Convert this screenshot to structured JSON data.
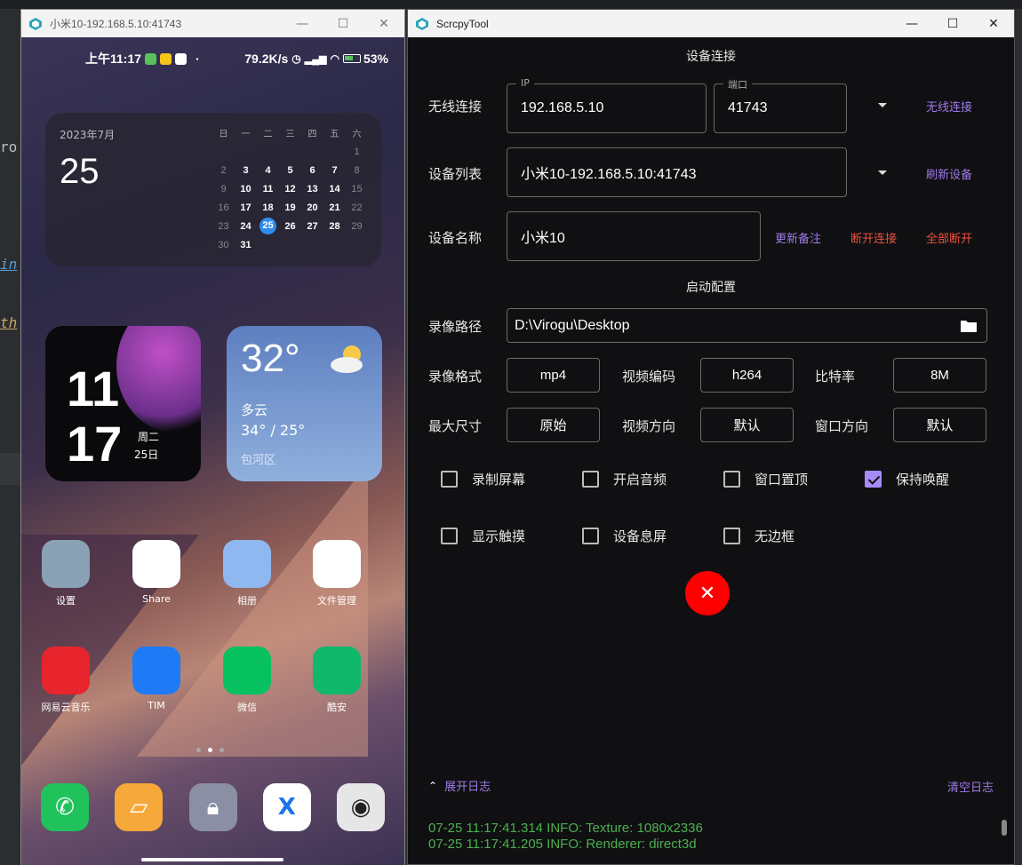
{
  "ide": {
    "frag1": "ro",
    "frag2": "in",
    "frag3": "th"
  },
  "phone_window": {
    "title": "小米10-192.168.5.10:41743",
    "minimize": "—",
    "maximize": "☐",
    "close": "✕"
  },
  "phone": {
    "status": {
      "time": "上午11:17",
      "speed": "79.2K/s",
      "battery": "53%"
    },
    "calendar": {
      "month": "2023年7月",
      "day": "25",
      "weekdays": [
        "日",
        "一",
        "二",
        "三",
        "四",
        "五",
        "六"
      ],
      "rows": [
        [
          "",
          "",
          "",
          "",
          "",
          "",
          "1"
        ],
        [
          "2",
          "3",
          "4",
          "5",
          "6",
          "7",
          "8"
        ],
        [
          "9",
          "10",
          "11",
          "12",
          "13",
          "14",
          "15"
        ],
        [
          "16",
          "17",
          "18",
          "19",
          "20",
          "21",
          "22"
        ],
        [
          "23",
          "24",
          "25",
          "26",
          "27",
          "28",
          "29"
        ],
        [
          "30",
          "31",
          "",
          "",
          "",
          "",
          ""
        ]
      ],
      "today": "25"
    },
    "clock": {
      "hour": "11",
      "minute": "17",
      "weekday": "周二",
      "date": "25日"
    },
    "weather": {
      "temp": "32°",
      "condition": "多云",
      "range": "34° / 25°",
      "location": "包河区"
    },
    "apps_row1": [
      {
        "label": "设置",
        "icon": "settings-icon",
        "bg": "#8aa0b4"
      },
      {
        "label": "Share",
        "icon": "share-icon",
        "bg": "#ffffff"
      },
      {
        "label": "相册",
        "icon": "gallery-icon",
        "bg": "#8fb8f0"
      },
      {
        "label": "文件管理",
        "icon": "folder-icon",
        "bg": "#ffffff"
      }
    ],
    "apps_row2": [
      {
        "label": "网易云音乐",
        "icon": "netease-music-icon",
        "bg": "#e8242c"
      },
      {
        "label": "TIM",
        "icon": "tim-icon",
        "bg": "#1e7bf5"
      },
      {
        "label": "微信",
        "icon": "wechat-icon",
        "bg": "#07c160"
      },
      {
        "label": "酷安",
        "icon": "coolapk-icon",
        "bg": "#10b86b"
      }
    ]
  },
  "tool_window": {
    "title": "ScrcpyTool",
    "minimize": "—",
    "maximize": "☐",
    "close": "✕",
    "connect_section": "设备连接",
    "wireless_label": "无线连接",
    "ip_legend": "IP",
    "ip_value": "192.168.5.10",
    "port_legend": "端口",
    "port_value": "41743",
    "wireless_connect_link": "无线连接",
    "device_list_label": "设备列表",
    "device_list_value": "小米10-192.168.5.10:41743",
    "refresh_link": "刷新设备",
    "device_name_label": "设备名称",
    "device_name_value": "小米10",
    "update_note_link": "更新备注",
    "disconnect_link": "断开连接",
    "disconnect_all_link": "全部断开",
    "launch_section": "启动配置",
    "record_path_label": "录像路径",
    "record_path_value": "D:\\Virogu\\Desktop",
    "record_format_label": "录像格式",
    "record_format_value": "mp4",
    "video_codec_label": "视频编码",
    "video_codec_value": "h264",
    "bitrate_label": "比特率",
    "bitrate_value": "8M",
    "max_size_label": "最大尺寸",
    "max_size_value": "原始",
    "video_orient_label": "视频方向",
    "video_orient_value": "默认",
    "window_orient_label": "窗口方向",
    "window_orient_value": "默认",
    "checkboxes": [
      {
        "label": "录制屏幕",
        "checked": false
      },
      {
        "label": "开启音频",
        "checked": false
      },
      {
        "label": "窗口置顶",
        "checked": false
      },
      {
        "label": "保持唤醒",
        "checked": true
      },
      {
        "label": "显示触摸",
        "checked": false
      },
      {
        "label": "设备息屏",
        "checked": false
      },
      {
        "label": "无边框",
        "checked": false
      }
    ],
    "stop_symbol": "✕",
    "expand_log": "展开日志",
    "clear_log": "清空日志",
    "log_lines": [
      "07-25 11:17:41.314 INFO: Texture: 1080x2336",
      "07-25 11:17:41.205 INFO: Renderer: direct3d"
    ],
    "accent": "#9f7aea",
    "danger": "#f0513e"
  }
}
